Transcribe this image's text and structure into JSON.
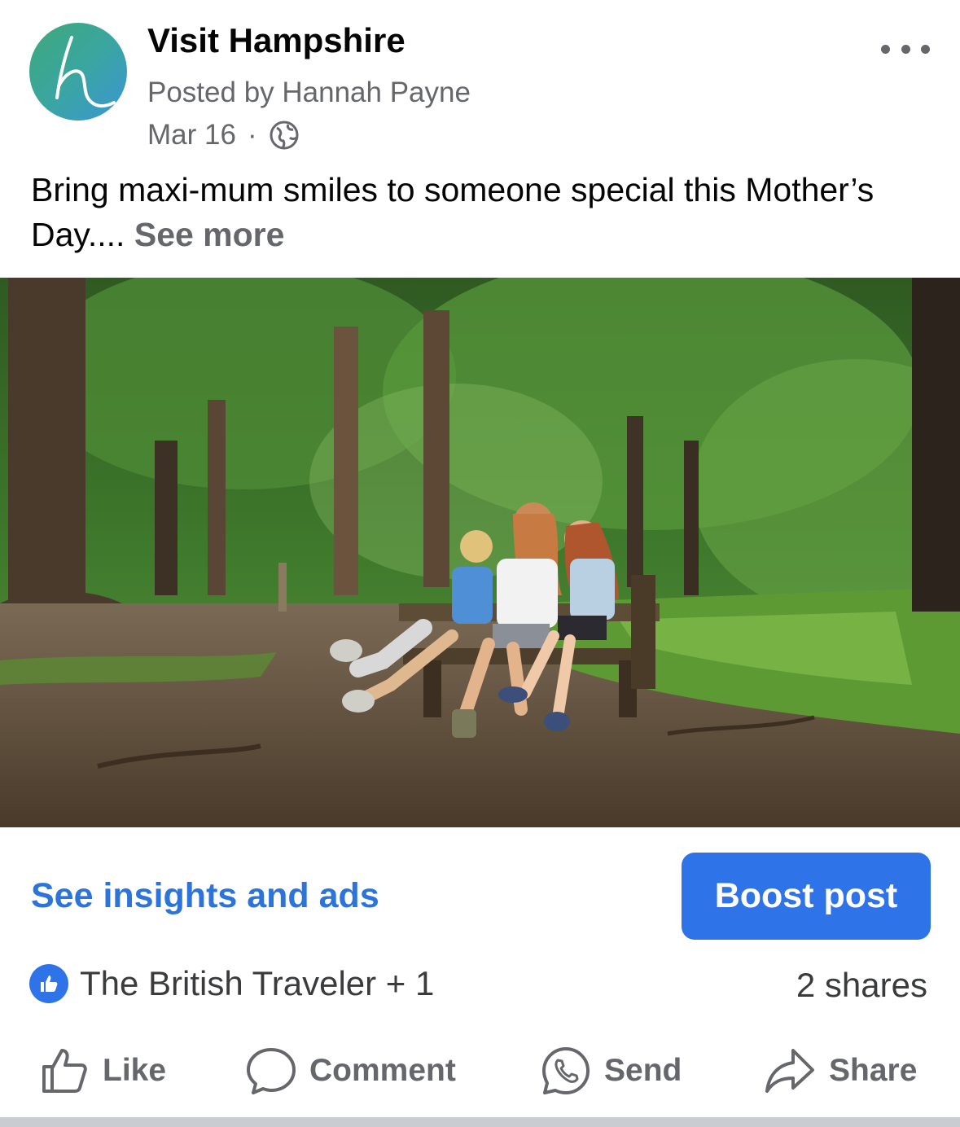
{
  "post": {
    "page_name": "Visit Hampshire",
    "posted_by": "Posted by Hannah Payne",
    "date": "Mar 16",
    "separator": "·",
    "audience_icon": "globe-icon",
    "more_icon": "more-options-icon",
    "caption": "Bring maxi-mum smiles to someone special this Mother’s Day....",
    "see_more": "See more",
    "photo_description_icon": "forest-bench-photo"
  },
  "promo": {
    "insights_label": "See insights and ads",
    "boost_label": "Boost post",
    "boost_color": "#2f73e8",
    "link_color": "#2d74da"
  },
  "engagement": {
    "reactors": "The British Traveler + 1",
    "shares": "2 shares",
    "reaction_icon": "like-reaction-icon"
  },
  "actions": [
    {
      "label": "Like",
      "icon": "thumbs-up-icon"
    },
    {
      "label": "Comment",
      "icon": "comment-bubble-icon"
    },
    {
      "label": "Send",
      "icon": "whatsapp-icon"
    },
    {
      "label": "Share",
      "icon": "share-arrow-icon"
    }
  ]
}
